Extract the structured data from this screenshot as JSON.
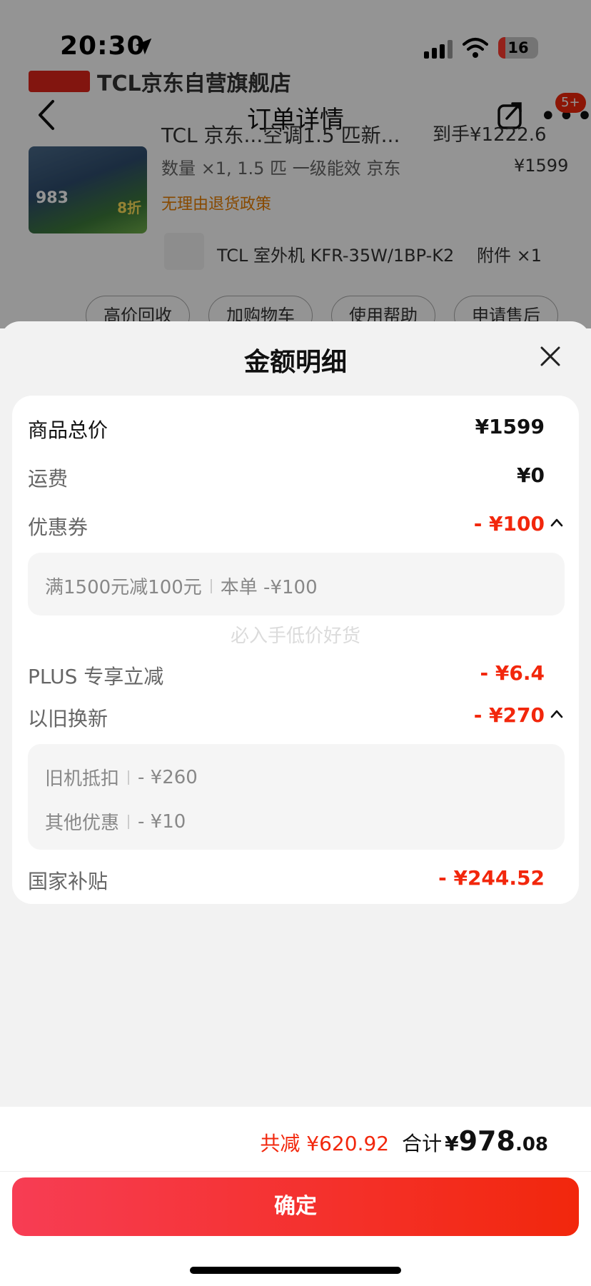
{
  "status_bar": {
    "time": "20:30",
    "battery": "16",
    "icons": [
      "location-arrow-icon",
      "signal-icon",
      "wifi-icon",
      "battery-icon"
    ]
  },
  "background": {
    "store_name": "TCL京东自营旗舰店",
    "nav_title": "订单详情",
    "more_badge": "5+",
    "product": {
      "title": "TCL 京东...空调1.5 匹新...",
      "price_top": "到手¥1222.6",
      "spec": "数量 ×1, 1.5 匹 一级能效 京东",
      "price": "¥1599",
      "image_price": "983",
      "image_tag": "8折",
      "return_policy": "无理由退货政策"
    },
    "accessory": {
      "name": "TCL 室外机 KFR-35W/1BP-K2",
      "qty": "附件 ×1"
    },
    "actions": [
      "高价回收",
      "加购物车",
      "使用帮助",
      "申请售后"
    ]
  },
  "sheet": {
    "title": "金额明细",
    "rows": {
      "goods_total": {
        "label": "商品总价",
        "value": "¥1599"
      },
      "shipping": {
        "label": "运费",
        "value": "¥0"
      },
      "coupon": {
        "label": "优惠券",
        "value": "- ¥100",
        "detail": {
          "name": "满1500元减100元",
          "value": "本单 -¥100"
        }
      },
      "plus": {
        "label": "PLUS 专享立减",
        "value": "- ¥6.4"
      },
      "trade_in": {
        "label": "以旧换新",
        "value": "- ¥270",
        "details": [
          {
            "name": "旧机抵扣",
            "value": "- ¥260"
          },
          {
            "name": "其他优惠",
            "value": "- ¥10"
          }
        ]
      },
      "subsidy": {
        "label": "国家补贴",
        "value": "- ¥244.52"
      }
    },
    "watermark": "必入手低价好货"
  },
  "footer": {
    "saved": "共减 ¥620.92",
    "total_label": "合计",
    "total_currency": "¥",
    "total_int": "978",
    "total_dec": ".08",
    "confirm": "确定"
  },
  "colors": {
    "accent": "#f2270c",
    "confirm_gradient_start": "#f73d54",
    "confirm_gradient_end": "#f2270c"
  }
}
